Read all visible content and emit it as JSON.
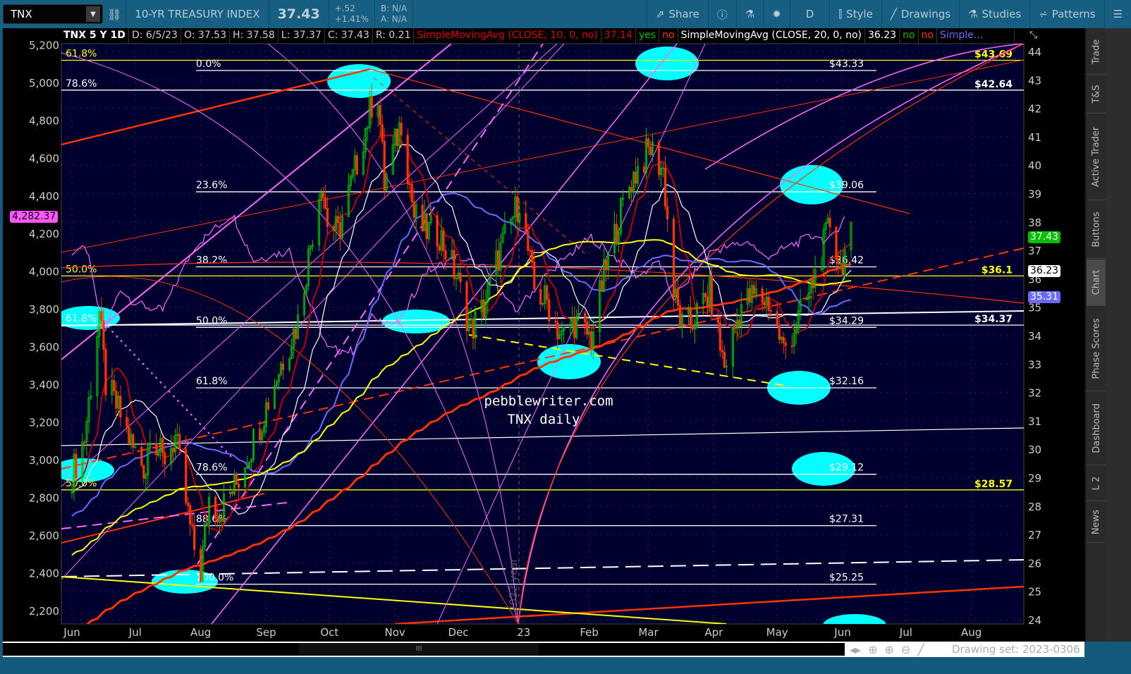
{
  "toolbar": {
    "symbol": "TNX",
    "description": "10-YR TREASURY INDEX",
    "last": "37.43",
    "change": "+.52",
    "change_pct": "+1.41%",
    "bid": "B: N/A",
    "ask": "A: N/A",
    "buttons": [
      {
        "label": "Share",
        "icon": "share-icon"
      },
      {
        "label": "",
        "icon": "info-icon"
      },
      {
        "label": "",
        "icon": "flask-icon"
      },
      {
        "label": "",
        "icon": "gear-icon"
      },
      {
        "label": "D",
        "icon": ""
      },
      {
        "label": "Style",
        "icon": "candle-icon"
      },
      {
        "label": "Drawings",
        "icon": "pencil-icon"
      },
      {
        "label": "Studies",
        "icon": "flask-icon"
      },
      {
        "label": "Patterns",
        "icon": "patterns-icon"
      },
      {
        "label": "",
        "icon": "menu-icon"
      }
    ]
  },
  "info": {
    "title": "TNX 5 Y 1D",
    "date": "D: 6/5/23",
    "open": "O: 37.53",
    "high": "H: 37.58",
    "low": "L: 37.37",
    "close": "C: 37.43",
    "range": "R: 0.21",
    "sma1": "SimpleMovingAvg (CLOSE, 10, 0, no)",
    "sma1_val": "37.14",
    "sma1_a": "yes",
    "sma1_b": "no",
    "sma2": "SimpleMovingAvg (CLOSE, 20, 0, no)",
    "sma2_val": "36.23",
    "sma2_a": "no",
    "sma2_b": "no",
    "sma3": "Simple..."
  },
  "sidebar": [
    "Trade",
    "T&S",
    "Active Trader",
    "Buttons",
    "Chart",
    "Phase Scores",
    "Dashboard",
    "L 2",
    "News"
  ],
  "bottom": {
    "drawing_set": "Drawing set: 2023-0306"
  },
  "colors": {
    "up": "#00c000",
    "down": "#ff3300",
    "sma10": "#c00000",
    "sma20": "#ffffff",
    "sma50": "#6a6aff",
    "sma100": "#ffff00",
    "sma200": "#ff3300",
    "spx": "#ff66ff",
    "cyan": "#00ffff",
    "bg": "#00002e"
  },
  "chart_data": {
    "type": "candlestick",
    "title": "TNX 5 Y 1D",
    "annotations": {
      "site": "pebblewriter.com",
      "subtitle": "TNX daily",
      "year_marker": "2022 year"
    },
    "right_axis": {
      "ticks": [
        24,
        25,
        26,
        27,
        28,
        29,
        30,
        31,
        32,
        33,
        34,
        35,
        36,
        37,
        38,
        39,
        40,
        41,
        42,
        43,
        44
      ],
      "range": [
        23.8,
        44.3
      ]
    },
    "left_axis": {
      "ticks": [
        "2,200",
        "2,400",
        "2,600",
        "2,800",
        "3,000",
        "3,200",
        "3,400",
        "3,600",
        "3,800",
        "4,000",
        "4,200",
        "4,400",
        "4,600",
        "4,800",
        "5,000",
        "5,200"
      ],
      "values": [
        2200,
        2400,
        2600,
        2800,
        3000,
        3200,
        3400,
        3600,
        3800,
        4000,
        4200,
        4400,
        4600,
        4800,
        5000,
        5200
      ]
    },
    "x_ticks": [
      [
        "Jun",
        "2022-06-01"
      ],
      [
        "Jul",
        "2022-07-01"
      ],
      [
        "Aug",
        "2022-08-01"
      ],
      [
        "Sep",
        "2022-09-01"
      ],
      [
        "Oct",
        "2022-10-01"
      ],
      [
        "Nov",
        "2022-11-01"
      ],
      [
        "Dec",
        "2022-12-01"
      ],
      [
        "23",
        "2023-01-01"
      ],
      [
        "Feb",
        "2023-02-01"
      ],
      [
        "Mar",
        "2023-03-01"
      ],
      [
        "Apr",
        "2023-04-01"
      ],
      [
        "May",
        "2023-05-01"
      ],
      [
        "Jun",
        "2023-06-01"
      ],
      [
        "Jul",
        "2023-07-01"
      ],
      [
        "Aug",
        "2023-08-01"
      ]
    ],
    "tnx_close": [
      [
        "2022-06-01",
        29.1
      ],
      [
        "2022-06-07",
        30.4
      ],
      [
        "2022-06-14",
        34.8
      ],
      [
        "2022-06-17",
        32.3
      ],
      [
        "2022-06-24",
        31.2
      ],
      [
        "2022-06-30",
        30.0
      ],
      [
        "2022-07-06",
        29.3
      ],
      [
        "2022-07-08",
        30.8
      ],
      [
        "2022-07-14",
        29.6
      ],
      [
        "2022-07-20",
        30.4
      ],
      [
        "2022-07-28",
        26.8
      ],
      [
        "2022-08-01",
        25.7
      ],
      [
        "2022-08-05",
        28.3
      ],
      [
        "2022-08-10",
        27.8
      ],
      [
        "2022-08-18",
        28.8
      ],
      [
        "2022-08-30",
        31.1
      ],
      [
        "2022-09-08",
        33.0
      ],
      [
        "2022-09-16",
        34.5
      ],
      [
        "2022-09-27",
        39.5
      ],
      [
        "2022-09-30",
        38.0
      ],
      [
        "2022-10-05",
        37.6
      ],
      [
        "2022-10-14",
        40.1
      ],
      [
        "2022-10-21",
        42.2
      ],
      [
        "2022-10-24",
        42.5
      ],
      [
        "2022-10-27",
        39.3
      ],
      [
        "2022-11-04",
        41.6
      ],
      [
        "2022-11-10",
        38.2
      ],
      [
        "2022-11-15",
        37.7
      ],
      [
        "2022-11-22",
        37.6
      ],
      [
        "2022-11-30",
        36.1
      ],
      [
        "2022-12-07",
        34.2
      ],
      [
        "2022-12-13",
        35.0
      ],
      [
        "2022-12-20",
        36.8
      ],
      [
        "2022-12-30",
        38.8
      ],
      [
        "2023-01-06",
        35.6
      ],
      [
        "2023-01-12",
        35.2
      ],
      [
        "2023-01-19",
        33.9
      ],
      [
        "2023-01-25",
        34.5
      ],
      [
        "2023-02-02",
        33.9
      ],
      [
        "2023-02-08",
        36.1
      ],
      [
        "2023-02-15",
        38.1
      ],
      [
        "2023-02-21",
        39.5
      ],
      [
        "2023-03-02",
        40.6
      ],
      [
        "2023-03-08",
        39.8
      ],
      [
        "2023-03-13",
        35.5
      ],
      [
        "2023-03-17",
        34.3
      ],
      [
        "2023-03-22",
        34.5
      ],
      [
        "2023-03-30",
        35.5
      ],
      [
        "2023-04-06",
        32.9
      ],
      [
        "2023-04-14",
        35.1
      ],
      [
        "2023-04-20",
        35.4
      ],
      [
        "2023-04-27",
        35.2
      ],
      [
        "2023-05-04",
        33.5
      ],
      [
        "2023-05-10",
        34.4
      ],
      [
        "2023-05-16",
        35.4
      ],
      [
        "2023-05-24",
        37.4
      ],
      [
        "2023-05-26",
        38.0
      ],
      [
        "2023-05-31",
        36.4
      ],
      [
        "2023-06-02",
        36.9
      ],
      [
        "2023-06-05",
        37.43
      ]
    ],
    "spx_close": [
      [
        "2022-06-01",
        4101
      ],
      [
        "2022-06-08",
        4115
      ],
      [
        "2022-06-16",
        3667
      ],
      [
        "2022-06-24",
        3912
      ],
      [
        "2022-07-01",
        3825
      ],
      [
        "2022-07-14",
        3790
      ],
      [
        "2022-07-29",
        4130
      ],
      [
        "2022-08-16",
        4305
      ],
      [
        "2022-08-26",
        4058
      ],
      [
        "2022-09-12",
        4110
      ],
      [
        "2022-09-30",
        3586
      ],
      [
        "2022-10-12",
        3577
      ],
      [
        "2022-10-21",
        3752
      ],
      [
        "2022-11-03",
        3720
      ],
      [
        "2022-11-15",
        3992
      ],
      [
        "2022-12-01",
        4076
      ],
      [
        "2022-12-13",
        4019
      ],
      [
        "2022-12-28",
        3783
      ],
      [
        "2023-01-13",
        3999
      ],
      [
        "2023-02-02",
        4179
      ],
      [
        "2023-02-24",
        3970
      ],
      [
        "2023-03-06",
        4048
      ],
      [
        "2023-03-13",
        3855
      ],
      [
        "2023-03-31",
        4109
      ],
      [
        "2023-04-18",
        4155
      ],
      [
        "2023-04-25",
        4071
      ],
      [
        "2023-05-19",
        4192
      ],
      [
        "2023-05-25",
        4151
      ],
      [
        "2023-06-02",
        4282
      ]
    ],
    "sma_periods": [
      10,
      20,
      50,
      100,
      200
    ],
    "fib_levels": [
      {
        "pct": "0.0%",
        "price": 43.33,
        "label": "$43.33"
      },
      {
        "pct": "23.6%",
        "price": 39.06,
        "label": "$39.06"
      },
      {
        "pct": "38.2%",
        "price": 36.42,
        "label": "$36.42"
      },
      {
        "pct": "50.0%",
        "price": 34.29,
        "label": "$34.29"
      },
      {
        "pct": "61.8%",
        "price": 32.16,
        "label": "$32.16"
      },
      {
        "pct": "78.6%",
        "price": 29.12,
        "label": "$29.12"
      },
      {
        "pct": "88.6%",
        "price": 27.31,
        "label": "$27.31"
      },
      {
        "pct": "100.0%",
        "price": 25.25,
        "label": "$25.25"
      }
    ],
    "long_levels": [
      {
        "pct": "61.8%",
        "price": 43.69,
        "label": "$43.69",
        "color": "#ffff00"
      },
      {
        "pct": "78.6%",
        "price": 42.64,
        "label": "$42.64",
        "color": "#ffffff"
      },
      {
        "pct": "50.0%",
        "price": 36.1,
        "label": "$36.1",
        "color": "#ffff00"
      },
      {
        "pct": "61.8%",
        "price": 34.37,
        "label": "$34.37",
        "color": "#ffffff"
      },
      {
        "pct": "50.0%",
        "price": 28.57,
        "label": "$28.57",
        "color": "#ffff00"
      }
    ],
    "badges": {
      "last": "37.43",
      "sma20": "36.23",
      "sma50": "35.31",
      "spx": "4,282.37"
    }
  }
}
